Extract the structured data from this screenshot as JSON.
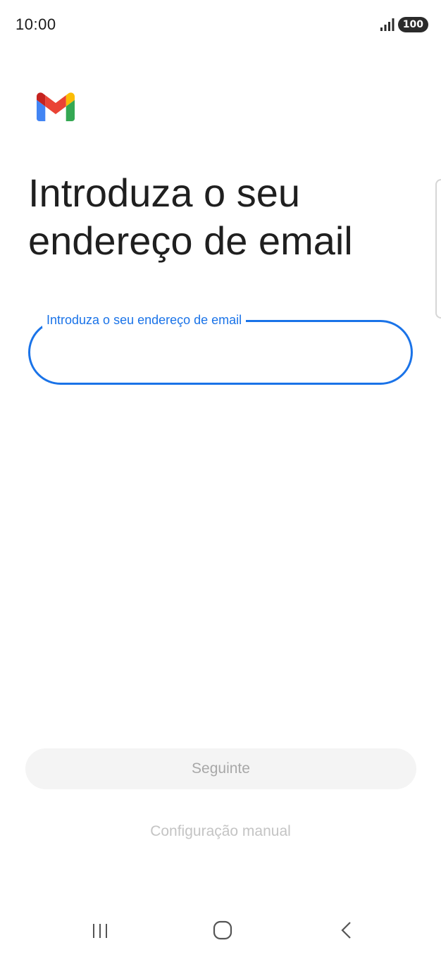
{
  "status_bar": {
    "time": "10:00",
    "battery": "100",
    "icons": [
      "signal-icon",
      "battery-icon"
    ]
  },
  "app": {
    "logo": "gmail-logo",
    "logo_colors": [
      "#4285F4",
      "#EA4335",
      "#FBBC04",
      "#34A853",
      "#C5221F"
    ]
  },
  "main": {
    "title": "Introduza o seu endereço de email",
    "email_field": {
      "label": "Introduza o seu endereço de email",
      "value": "",
      "accent_color": "#1a73e8"
    },
    "next_button_label": "Seguinte",
    "manual_setup_label": "Configuração manual"
  },
  "nav_bar": {
    "items": [
      "recents-icon",
      "home-icon",
      "back-icon"
    ]
  }
}
